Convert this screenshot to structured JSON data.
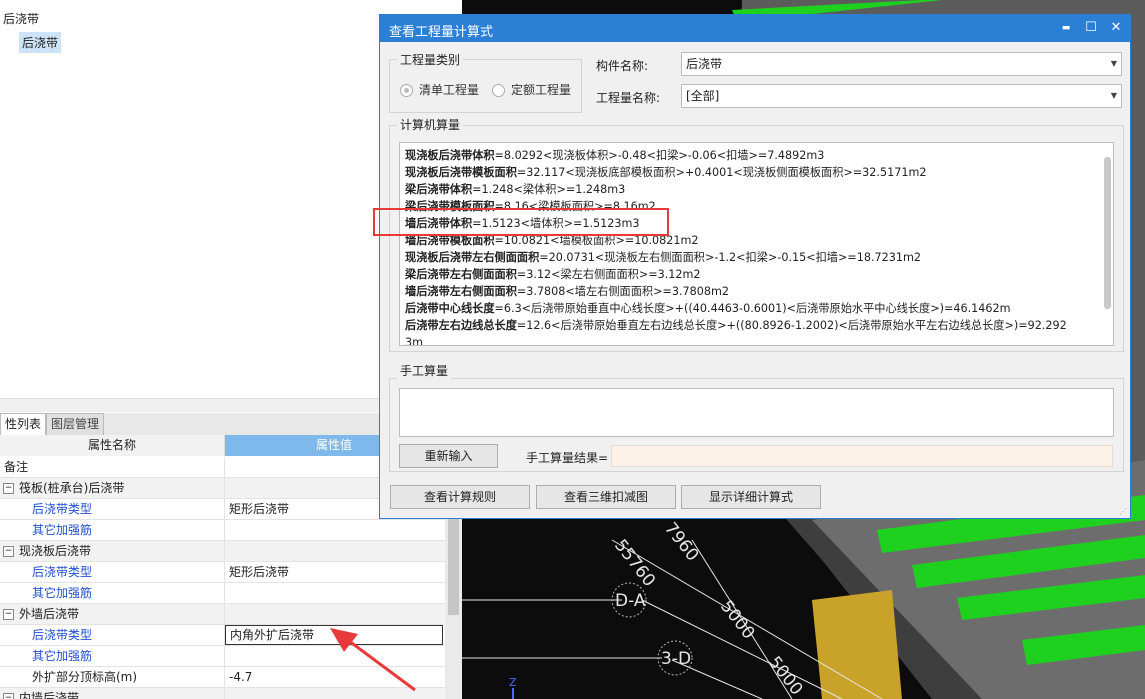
{
  "tree": {
    "root_label": "后浇带",
    "child_label": "后浇带"
  },
  "prop_tabs": [
    "性列表",
    "图层管理"
  ],
  "grid": {
    "col_name_header": "属性名称",
    "col_value_header": "属性值",
    "rows": [
      {
        "name": "备注",
        "value": "",
        "kind": "plain"
      },
      {
        "name": "筏板(桩承台)后浇带",
        "value": "",
        "kind": "group"
      },
      {
        "name": "后浇带类型",
        "value": "矩形后浇带",
        "kind": "child"
      },
      {
        "name": "其它加强筋",
        "value": "",
        "kind": "child"
      },
      {
        "name": "现浇板后浇带",
        "value": "",
        "kind": "group"
      },
      {
        "name": "后浇带类型",
        "value": "矩形后浇带",
        "kind": "child"
      },
      {
        "name": "其它加强筋",
        "value": "",
        "kind": "child"
      },
      {
        "name": "外墙后浇带",
        "value": "",
        "kind": "group"
      },
      {
        "name": "后浇带类型",
        "value": "内角外扩后浇带",
        "kind": "child-selected"
      },
      {
        "name": "其它加强筋",
        "value": "",
        "kind": "child"
      },
      {
        "name": "外扩部分顶标高(m)",
        "value": "-4.7",
        "kind": "child-plain"
      },
      {
        "name": "内墙后浇带",
        "value": "",
        "kind": "group"
      }
    ],
    "expander_symbol": "−"
  },
  "viewport": {
    "labels": [
      "55760",
      "7960",
      "D-A",
      "5000",
      "3-D",
      "5000"
    ],
    "axis_label": "Z",
    "colors": {
      "bg": "#0c0c0c",
      "green": "#1fd11f",
      "grid": "#e6e6e6"
    }
  },
  "dialog": {
    "title": "查看工程量计算式",
    "window_buttons": {
      "min": "▬",
      "max": "☐",
      "close": "✕"
    },
    "category_group_label": "工程量类别",
    "radio_bill": "清单工程量",
    "radio_quota": "定额工程量",
    "component_label": "构件名称:",
    "component_value": "后浇带",
    "quantity_label": "工程量名称:",
    "quantity_value": "[全部]",
    "computer_group_label": "计算机算量",
    "calc_lines": [
      {
        "bold": "现浇板后浇带体积",
        "rest": "=8.0292<现浇板体积>-0.48<扣梁>-0.06<扣墙>=7.4892m3"
      },
      {
        "bold": "现浇板后浇带模板面积",
        "rest": "=32.117<现浇板底部模板面积>+0.4001<现浇板侧面模板面积>=32.5171m2"
      },
      {
        "bold": "梁后浇带体积",
        "rest": "=1.248<梁体积>=1.248m3"
      },
      {
        "bold": "梁后浇带模板面积",
        "rest": "=8.16<梁模板面积>=8.16m2"
      },
      {
        "bold": "墙后浇带体积",
        "rest": "=1.5123<墙体积>=1.5123m3"
      },
      {
        "bold": "墙后浇带模板面积",
        "rest": "=10.0821<墙模板面积>=10.0821m2"
      },
      {
        "bold": "现浇板后浇带左右侧面面积",
        "rest": "=20.0731<现浇板左右侧面面积>-1.2<扣梁>-0.15<扣墙>=18.7231m2"
      },
      {
        "bold": "梁后浇带左右侧面面积",
        "rest": "=3.12<梁左右侧面面积>=3.12m2"
      },
      {
        "bold": "墙后浇带左右侧面面积",
        "rest": "=3.7808<墙左右侧面面积>=3.7808m2"
      },
      {
        "bold": "后浇带中心线长度",
        "rest": "=6.3<后浇带原始垂直中心线长度>+((40.4463-0.6001)<后浇带原始水平中心线长度>)=46.1462m"
      },
      {
        "bold": "后浇带左右边线总长度",
        "rest": "=12.6<后浇带原始垂直左右边线总长度>+((80.8926-1.2002)<后浇带原始水平左右边线总长度>)=92.292"
      },
      {
        "bold": "",
        "rest": "3m"
      }
    ],
    "manual_group_label": "手工算量",
    "manual_input_value": "",
    "reinput_button": "重新输入",
    "manual_result_label": "手工算量结果=",
    "manual_result_value": "",
    "bottom_buttons": [
      "查看计算规则",
      "查看三维扣减图",
      "显示详细计算式"
    ]
  }
}
